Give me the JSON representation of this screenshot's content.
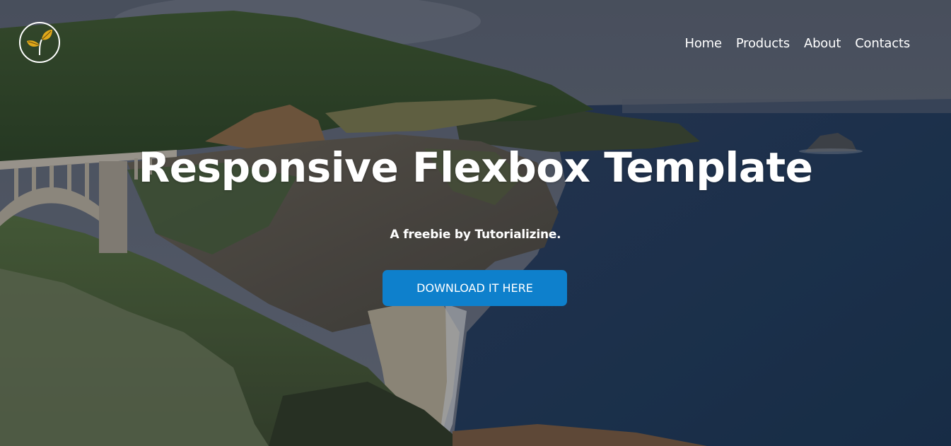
{
  "header": {
    "logo_icon": "sprout-leaf-icon",
    "logo_colors": {
      "ring": "#ffffff",
      "leaf": "#e0a81a"
    },
    "nav": [
      {
        "label": "Home"
      },
      {
        "label": "Products"
      },
      {
        "label": "About"
      },
      {
        "label": "Contacts"
      }
    ]
  },
  "hero": {
    "title": "Responsive Flexbox Template",
    "subtitle": "A freebie by Tutorializine.",
    "cta_label": "DOWNLOAD IT HERE",
    "cta_color": "#0e80cc"
  },
  "background": {
    "description_icon": "coastal-landscape-photo"
  }
}
